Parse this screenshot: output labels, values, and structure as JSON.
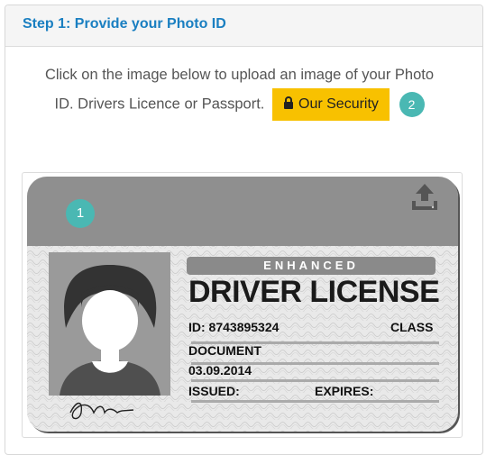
{
  "panel": {
    "title": "Step 1: Provide your Photo ID"
  },
  "instructions": {
    "line1": "Click on the image below to upload an image of your Photo",
    "line2": "ID. Drivers Licence or Passport.",
    "security_button": "Our Security",
    "badge": "2"
  },
  "license_card": {
    "badge": "1",
    "enhanced_label": "ENHANCED",
    "title": "DRIVER LICENSE",
    "id_line": "ID: 8743895324",
    "class_label": "CLASS",
    "document_label": "DOCUMENT",
    "document_date": "03.09.2014",
    "issued_label": "ISSUED:",
    "expires_label": "EXPIRES:",
    "icons": {
      "upload": "upload-icon",
      "lock": "lock-icon"
    }
  },
  "colors": {
    "accent_blue": "#1a7fc1",
    "security_yellow": "#f8c100",
    "badge_teal": "#4ab8b3",
    "card_gray": "#8f8f8f"
  }
}
